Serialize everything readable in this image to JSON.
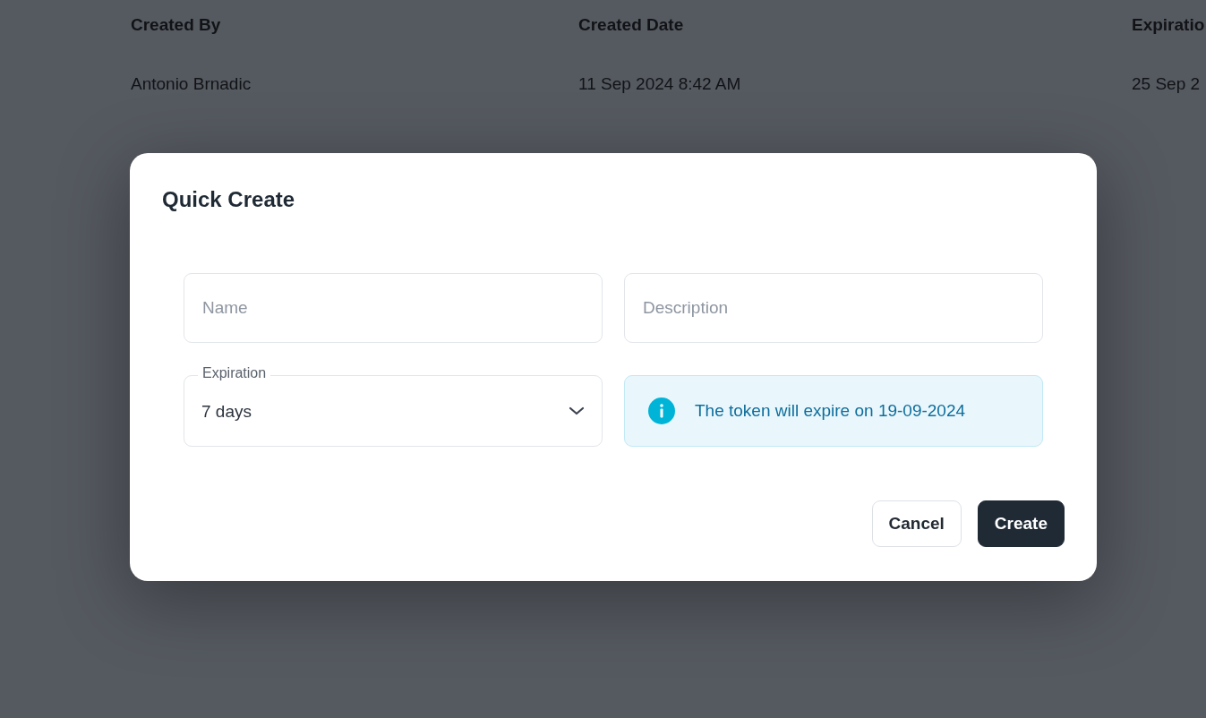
{
  "table": {
    "columns": [
      "Created By",
      "Created Date",
      "Expiratio"
    ],
    "rows": [
      {
        "cells": [
          "Antonio Brnadic",
          "11 Sep 2024 8:42 AM",
          "25 Sep 2"
        ]
      }
    ]
  },
  "dialog": {
    "title": "Quick Create",
    "fields": [
      {
        "kind": "text",
        "placeholder": "Name"
      },
      {
        "kind": "text",
        "placeholder": "Description"
      },
      {
        "kind": "select",
        "label": "Expiration",
        "value": "7 days"
      },
      {
        "kind": "info",
        "text": "The token will expire on 19-09-2024"
      }
    ],
    "buttons": [
      {
        "kind": "secondary",
        "label": "Cancel"
      },
      {
        "kind": "primary",
        "label": "Create"
      }
    ]
  }
}
